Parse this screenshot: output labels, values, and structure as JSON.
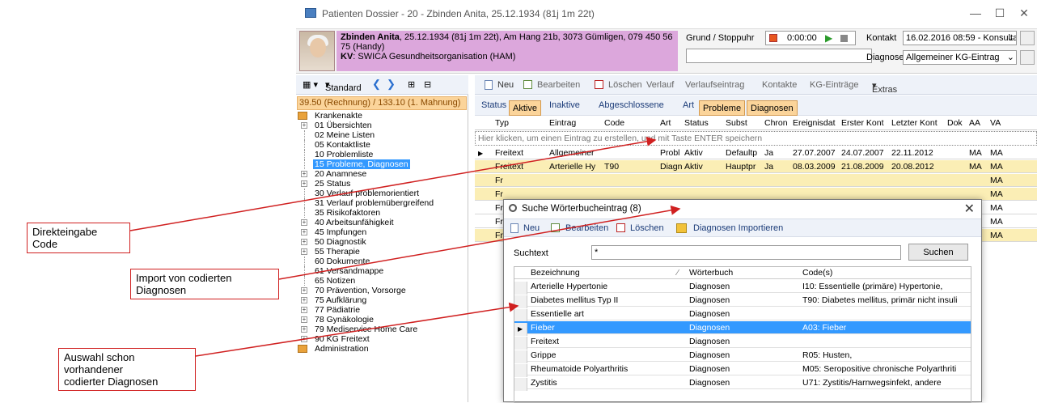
{
  "window": {
    "title": "Patienten Dossier - 20 - Zbinden Anita, 25.12.1934 (81j 1m 22t)"
  },
  "patient": {
    "name": "Zbinden Anita",
    "details": ", 25.12.1934 (81j 1m 22t), Am Hang 21b, 3073 Gümligen, 079 450 56 75 (Handy)",
    "kv_label": "KV",
    "kv_value": ": SWICA Gesundheitsorganisation (HAM)"
  },
  "header": {
    "grund_label": "Grund / Stoppuhr",
    "timer": "0:00:00",
    "kontakt_label": "Kontakt",
    "kontakt_value": "16.02.2016 08:59 - Konsultation",
    "diagnose_label": "Diagnose",
    "diagnose_value": "Allgemeiner KG-Eintrag"
  },
  "left": {
    "standard_label": "Standard",
    "balance": "39.50 (Rechnung) / 133.10 (1. Mahnung)",
    "tree": [
      {
        "label": "Krankenakte",
        "exp": "",
        "root": true
      },
      {
        "label": "01 Übersichten",
        "exp": "+"
      },
      {
        "label": "02 Meine Listen",
        "exp": ""
      },
      {
        "label": "05 Kontaktliste",
        "exp": ""
      },
      {
        "label": "10 Problemliste",
        "exp": ""
      },
      {
        "label": "15 Probleme, Diagnosen",
        "exp": "",
        "selected": true
      },
      {
        "label": "20 Anamnese",
        "exp": "+"
      },
      {
        "label": "25 Status",
        "exp": "+"
      },
      {
        "label": "30 Verlauf problemorientiert",
        "exp": ""
      },
      {
        "label": "31 Verlauf problemübergreifend",
        "exp": ""
      },
      {
        "label": "35 Risikofaktoren",
        "exp": ""
      },
      {
        "label": "40 Arbeitsunfähigkeit",
        "exp": "+"
      },
      {
        "label": "45 Impfungen",
        "exp": "+"
      },
      {
        "label": "50 Diagnostik",
        "exp": "+"
      },
      {
        "label": "55 Therapie",
        "exp": "+"
      },
      {
        "label": "60 Dokumente",
        "exp": ""
      },
      {
        "label": "61 Versandmappe",
        "exp": ""
      },
      {
        "label": "65 Notizen",
        "exp": ""
      },
      {
        "label": "70 Prävention, Vorsorge",
        "exp": "+"
      },
      {
        "label": "75 Aufklärung",
        "exp": "+"
      },
      {
        "label": "77 Pädiatrie",
        "exp": "+"
      },
      {
        "label": "78 Gynäkologie",
        "exp": "+"
      },
      {
        "label": "79 Mediservice Home Care",
        "exp": "+"
      },
      {
        "label": "90 KG Freitext",
        "exp": "+"
      },
      {
        "label": "Administration",
        "exp": "",
        "root": true
      }
    ]
  },
  "toolbar": {
    "neu": "Neu",
    "bearbeiten": "Bearbeiten",
    "loeschen": "Löschen",
    "verlauf": "Verlauf",
    "verlaufseintrag": "Verlaufseintrag",
    "kontakte": "Kontakte",
    "kg_eintraege": "KG-Einträge",
    "extras": "Extras"
  },
  "filter": {
    "status": "Status",
    "aktive": "Aktive",
    "inaktive": "Inaktive",
    "abgeschlossene": "Abgeschlossene",
    "art": "Art",
    "probleme": "Probleme",
    "diagnosen": "Diagnosen"
  },
  "grid": {
    "columns": [
      "Typ",
      "Eintrag",
      "Code",
      "Art",
      "Status",
      "Subst",
      "Chron",
      "Ereignisdat",
      "Erster Kont",
      "Letzter Kont",
      "Dok",
      "AA",
      "VA"
    ],
    "new_row_hint": "Hier klicken, um einen Eintrag zu erstellen, und mit Taste ENTER speichern",
    "rows": [
      {
        "typ": "Freitext",
        "eintrag": "Allgemeiner",
        "code": "",
        "art": "Probl",
        "status": "Aktiv",
        "subst": "Defaultp",
        "chron": "Ja",
        "ereignis": "27.07.2007",
        "erster": "24.07.2007",
        "letzter": "22.11.2012",
        "aa": "MA",
        "va": "MA",
        "yellow": false
      },
      {
        "typ": "Freitext",
        "eintrag": "Arterielle Hy",
        "code": "T90",
        "art": "Diagn",
        "status": "Aktiv",
        "subst": "Hauptpr",
        "chron": "Ja",
        "ereignis": "08.03.2009",
        "erster": "21.08.2009",
        "letzter": "20.08.2012",
        "aa": "MA",
        "va": "MA",
        "yellow": true
      },
      {
        "typ": "Fr",
        "eintrag": "",
        "code": "",
        "art": "",
        "status": "",
        "subst": "",
        "chron": "",
        "ereignis": "",
        "erster": "",
        "letzter": "",
        "aa": "",
        "va": "MA",
        "yellow": true
      },
      {
        "typ": "Fr",
        "eintrag": "",
        "code": "",
        "art": "",
        "status": "",
        "subst": "",
        "chron": "",
        "ereignis": "",
        "erster": "",
        "letzter": "",
        "aa": "",
        "va": "MA",
        "yellow": true
      },
      {
        "typ": "Fr",
        "eintrag": "",
        "code": "",
        "art": "",
        "status": "",
        "subst": "",
        "chron": "",
        "ereignis": "",
        "erster": "",
        "letzter": "",
        "aa": "",
        "va": "MA",
        "yellow": false
      },
      {
        "typ": "Fr",
        "eintrag": "",
        "code": "",
        "art": "",
        "status": "",
        "subst": "",
        "chron": "",
        "ereignis": "",
        "erster": "",
        "letzter": "",
        "aa": "",
        "va": "MA",
        "yellow": false
      },
      {
        "typ": "Fr",
        "eintrag": "",
        "code": "",
        "art": "",
        "status": "",
        "subst": "",
        "chron": "",
        "ereignis": "",
        "erster": "",
        "letzter": "",
        "aa": "",
        "va": "MA",
        "yellow": true
      }
    ]
  },
  "dialog": {
    "title": "Suche Wörterbucheintrag (8)",
    "neu": "Neu",
    "bearbeiten": "Bearbeiten",
    "loeschen": "Löschen",
    "importieren": "Diagnosen Importieren",
    "suchtext_label": "Suchtext",
    "suchtext_value": "*",
    "suchen": "Suchen",
    "columns": [
      "Bezeichnung",
      "Wörterbuch",
      "Code(s)"
    ],
    "rows": [
      {
        "bez": "Arterielle Hypertonie",
        "wb": "Diagnosen",
        "code": "I10: Essentielle (primäre) Hypertonie,"
      },
      {
        "bez": "Diabetes mellitus Typ II",
        "wb": "Diagnosen",
        "code": "T90: Diabetes mellitus, primär nicht insuli"
      },
      {
        "bez": "Essentielle art",
        "wb": "Diagnosen",
        "code": ""
      },
      {
        "bez": "Fieber",
        "wb": "Diagnosen",
        "code": "A03: Fieber",
        "selected": true
      },
      {
        "bez": "Freitext",
        "wb": "Diagnosen",
        "code": ""
      },
      {
        "bez": "Grippe",
        "wb": "Diagnosen",
        "code": "R05: Husten,"
      },
      {
        "bez": "Rheumatoide Polyarthritis",
        "wb": "Diagnosen",
        "code": "M05: Seropositive chronische Polyarthriti"
      },
      {
        "bez": "Zystitis",
        "wb": "Diagnosen",
        "code": "U71: Zystitis/Harnwegsinfekt, andere"
      }
    ]
  },
  "callouts": {
    "code": "Direkteingabe Code",
    "import_line1": "Import von codierten",
    "import_line2": "Diagnosen",
    "auswahl_line1": "Auswahl schon",
    "auswahl_line2": "vorhandener",
    "auswahl_line3": "codierter Diagnosen"
  },
  "colors": {
    "accent": "#3399ff",
    "patient_bg": "#dca7dc",
    "toggle_bg": "#fbd49a",
    "row_yellow": "#fbeeb5",
    "callout_red": "#d02020"
  }
}
